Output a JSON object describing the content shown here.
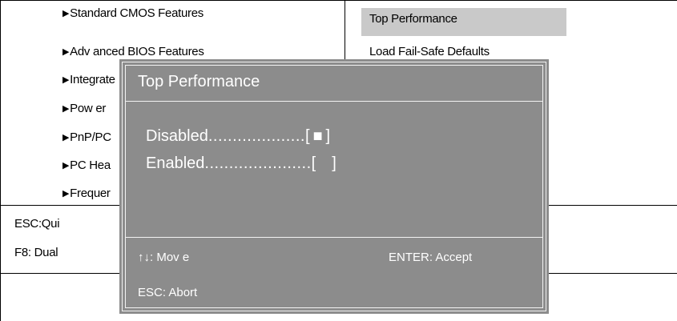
{
  "main_menu": {
    "items": [
      {
        "arrow": "▶",
        "label": "Standard CMOS Features"
      },
      {
        "arrow": "▶",
        "label": "Adv anced BIOS Features"
      },
      {
        "arrow": "▶",
        "label": "Integrate"
      },
      {
        "arrow": "▶",
        "label": "Pow er "
      },
      {
        "arrow": "▶",
        "label": "PnP/PC"
      },
      {
        "arrow": "▶",
        "label": "PC Hea"
      },
      {
        "arrow": "▶",
        "label": "Frequer"
      }
    ],
    "right_items": [
      {
        "label": "Top Performance",
        "selected": true
      },
      {
        "label": "Load Fail-Safe Defaults",
        "selected": false
      }
    ]
  },
  "footer": {
    "line1": "ESC:Qui",
    "line2": "F8: Dual"
  },
  "dialog": {
    "title": "Top Performance",
    "options": [
      {
        "name": "Disabled",
        "dots": "....................",
        "bracket_open": "[",
        "mark": "■",
        "bracket_close": "]",
        "selected": true
      },
      {
        "name": "Enabled",
        "dots": "......................",
        "bracket_open": "[",
        "mark": " ",
        "bracket_close": "]",
        "selected": false
      }
    ],
    "hint_move": "↑↓: Mov e",
    "hint_accept": "ENTER: Accept",
    "hint_abort": "ESC: Abort"
  },
  "colors": {
    "dialog_bg": "#8c8c8c",
    "highlight": "#c9c9c9",
    "text_on_dialog": "#ffffff"
  }
}
